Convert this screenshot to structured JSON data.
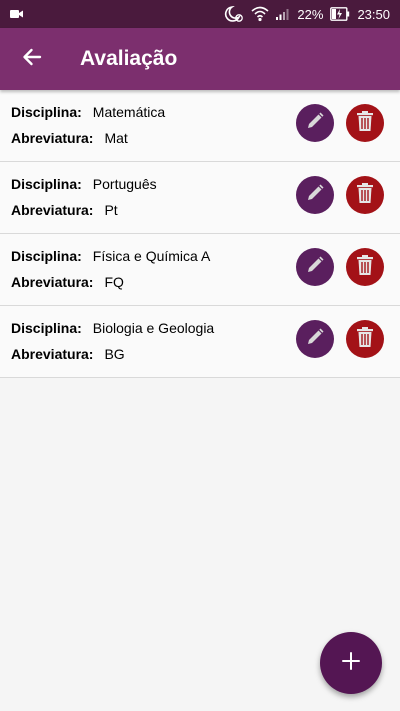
{
  "status_bar": {
    "battery": "22%",
    "time": "23:50",
    "icons": [
      "video-camera-icon",
      "moon-alarm-icon",
      "wifi-icon",
      "signal-icon",
      "battery-charging-icon"
    ]
  },
  "app_bar": {
    "title": "Avaliação",
    "back_icon": "arrow-left-icon",
    "color": "#7c2f6e"
  },
  "labels": {
    "discipline": "Disciplina:",
    "abbreviation": "Abreviatura:"
  },
  "items": [
    {
      "discipline": "Matemática",
      "abbreviation": "Mat"
    },
    {
      "discipline": "Português",
      "abbreviation": "Pt"
    },
    {
      "discipline": "Física e Química A",
      "abbreviation": "FQ"
    },
    {
      "discipline": "Biologia e Geologia",
      "abbreviation": "BG"
    }
  ],
  "actions": {
    "edit_icon": "pencil-icon",
    "edit_color": "#5a1f5e",
    "delete_icon": "trash-icon",
    "delete_color": "#a31217"
  },
  "fab": {
    "icon": "plus-icon",
    "color": "#541653"
  }
}
